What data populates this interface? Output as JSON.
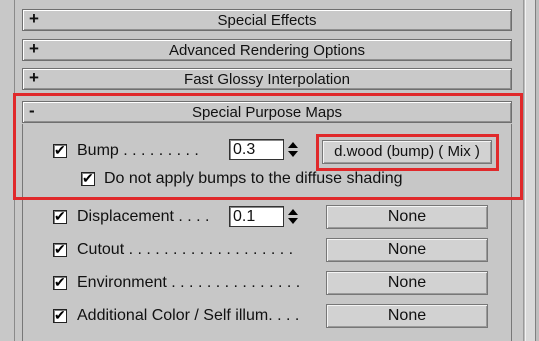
{
  "rollouts": [
    {
      "sign": "+",
      "title": "Special Effects"
    },
    {
      "sign": "+",
      "title": "Advanced Rendering Options"
    },
    {
      "sign": "+",
      "title": "Fast Glossy Interpolation"
    },
    {
      "sign": "-",
      "title": "Special Purpose Maps"
    }
  ],
  "special_purpose_maps": {
    "bump": {
      "label": "Bump . . . . . . . . .",
      "value": "0.3",
      "map": "d.wood (bump)  ( Mix )",
      "checked": true
    },
    "no_diffuse_bump": {
      "label": "Do not apply bumps to the diffuse shading",
      "checked": true
    },
    "displacement": {
      "label": "Displacement . . . .",
      "value": "0.1",
      "map": "None",
      "checked": true
    },
    "cutout": {
      "label": "Cutout . . . . . . . . . . . . . . . . . . .",
      "map": "None",
      "checked": true
    },
    "environment": {
      "label": "Environment . . . . . . . . . . . . . . .",
      "map": "None",
      "checked": true
    },
    "additional_color": {
      "label": "Additional Color / Self illum. . . .",
      "map": "None",
      "checked": true
    }
  },
  "colors": {
    "highlight": "#e0292b",
    "panel": "#c8c8c8"
  }
}
